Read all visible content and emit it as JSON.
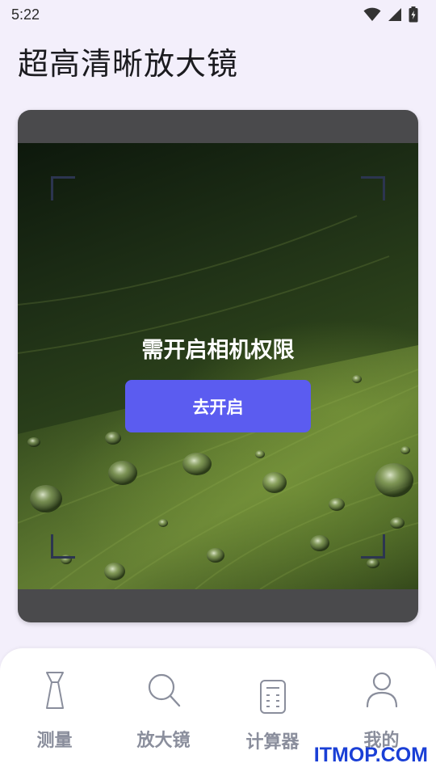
{
  "status_bar": {
    "time": "5:22",
    "icons": [
      "wifi-icon",
      "cellular-icon",
      "battery-charging-icon"
    ]
  },
  "app": {
    "title": "超高清晰放大镜"
  },
  "camera": {
    "permission_text": "需开启相机权限",
    "permission_button": "去开启"
  },
  "bottom_nav": {
    "items": [
      {
        "label": "测量",
        "icon": "ruler-icon"
      },
      {
        "label": "放大镜",
        "icon": "magnifier-icon"
      },
      {
        "label": "计算器",
        "icon": "calculator-icon"
      },
      {
        "label": "我的",
        "icon": "person-icon"
      }
    ]
  },
  "watermark": {
    "text": "ITMOP.COM"
  },
  "colors": {
    "background": "#f3effb",
    "accent": "#5b5cf0",
    "nav_text": "#8a8e9c",
    "card": "#4a4a4c"
  }
}
